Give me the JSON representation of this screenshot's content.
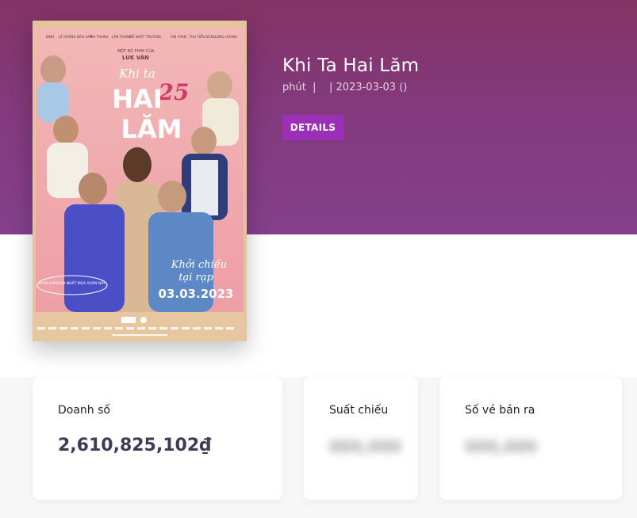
{
  "movie": {
    "title": "Khi Ta Hai Lăm",
    "meta_minutes": "phút",
    "meta_sep1": "  |    ",
    "meta_date": "| 2023-03-03 ()",
    "details_label": "DETAILS"
  },
  "poster": {
    "cast_names": [
      "BINH",
      "LÊ HOÀNG BẢO LÂM",
      "PHI THANH",
      "LÂM THANH",
      "ĐỖ NHẬT TRƯỜNG",
      "VIN VYAN",
      "THÚ TIẾN DŨNG",
      "LONG HOANG"
    ],
    "director_line": "MỘT BỘ PHIM CỦA",
    "director": "LUK VÂN",
    "title_top": "Khi ta",
    "title_main": "HAI",
    "title_bottom": "LĂM",
    "title_number": "25",
    "tagline_1": "Khởi chiếu",
    "tagline_2": "tại rạp",
    "release": "03.03.2023",
    "subtag": "PHIM UPMOOD NHẤT MÙA XUÂN NÀY"
  },
  "stats": {
    "revenue_label": "Doanh số",
    "revenue_value": "2,610,825,102₫",
    "screenings_label": "Suất chiếu",
    "screenings_value": "000,000",
    "tickets_label": "Số vé bán ra",
    "tickets_value": "000,000"
  },
  "colors": {
    "hero_top": "#833365",
    "hero_bottom": "#84408c",
    "button": "#9c2fb8"
  }
}
